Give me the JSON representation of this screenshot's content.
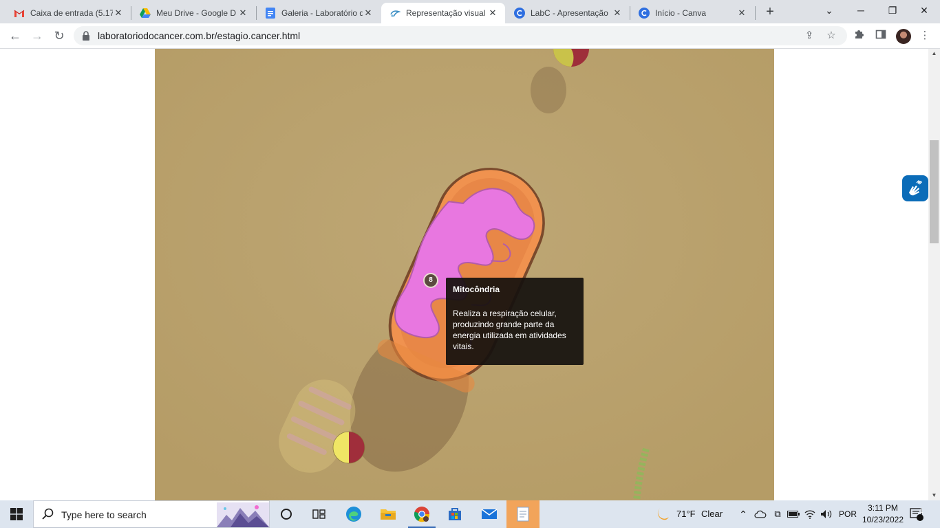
{
  "tabs": [
    {
      "title": "Caixa de entrada (5.17",
      "icon": "gmail-icon"
    },
    {
      "title": "Meu Drive - Google D",
      "icon": "google-drive-icon"
    },
    {
      "title": "Galeria - Laboratório d",
      "icon": "google-docs-icon"
    },
    {
      "title": "Representação visual d",
      "icon": "site-favicon"
    },
    {
      "title": "LabC - Apresentação",
      "icon": "canva-icon"
    },
    {
      "title": "Início - Canva",
      "icon": "canva-icon"
    }
  ],
  "address_bar": {
    "url": "laboratoriodocancer.com.br/estagio.cancer.html"
  },
  "scene": {
    "marker_number": "8",
    "tooltip": {
      "title": "Mitocôndria",
      "text": "Realiza a respiração celular, produzindo grande parte da energia utilizada em atividades vitais."
    }
  },
  "taskbar": {
    "search_placeholder": "Type here to search",
    "weather_temp": "71°F",
    "weather_desc": "Clear",
    "language": "POR",
    "time": "3:11 PM",
    "date": "10/23/2022",
    "notification_count": "1"
  },
  "colors": {
    "scene_background": "#b8a16e",
    "mitochondria_outer": "#f0924f",
    "mitochondria_cristae": "#e877e0",
    "taskbar": "#dde5ef",
    "tab_strip": "#dee1e6"
  }
}
